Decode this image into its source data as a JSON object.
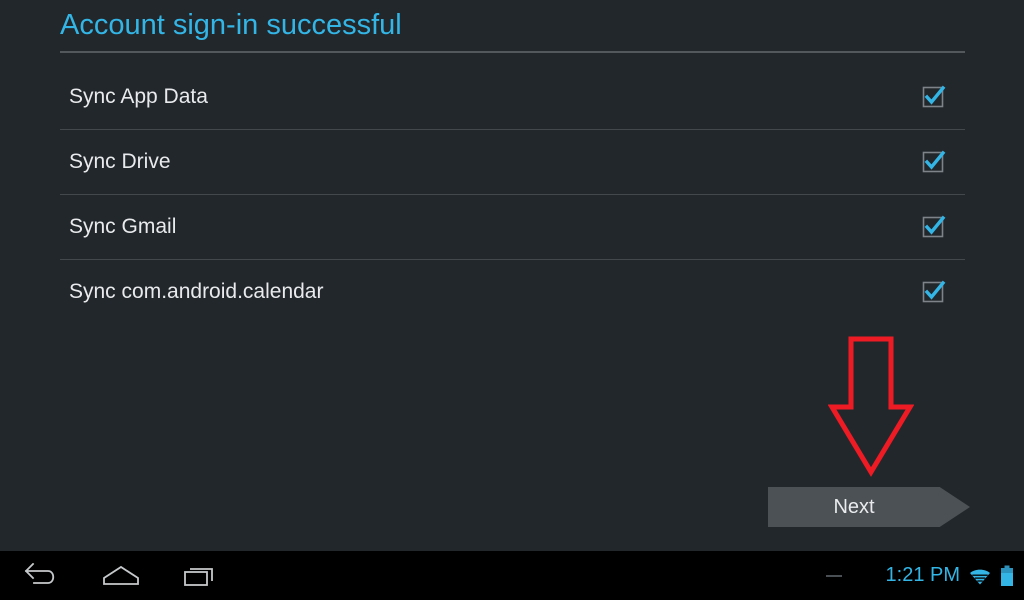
{
  "page": {
    "title": "Account sign-in successful",
    "background_color": "#22272c",
    "accent_color": "#33b5e5"
  },
  "sync_list": {
    "items": [
      {
        "label": "Sync App Data",
        "checked": true,
        "checkbox_icon": "checkbox-checked-icon"
      },
      {
        "label": "Sync Drive",
        "checked": true,
        "checkbox_icon": "checkbox-checked-icon"
      },
      {
        "label": "Sync Gmail",
        "checked": true,
        "checkbox_icon": "checkbox-checked-icon"
      },
      {
        "label": "Sync com.android.calendar",
        "checked": true,
        "checkbox_icon": "checkbox-checked-icon"
      }
    ]
  },
  "annotation": {
    "arrow_icon": "down-arrow-annotation-icon",
    "arrow_color": "#ee1b24"
  },
  "next_button": {
    "label": "Next",
    "fill_color": "#4c5155",
    "text_color": "#e9ebed"
  },
  "nav_bar": {
    "background_color": "#000000",
    "buttons": [
      {
        "name": "back-icon",
        "label": "Back"
      },
      {
        "name": "home-icon",
        "label": "Home"
      },
      {
        "name": "recents-icon",
        "label": "Recent apps"
      }
    ]
  },
  "status_bar": {
    "clock": "1:21 PM",
    "clock_color": "#33b5e5",
    "wifi_icon": "wifi-icon",
    "battery_icon": "battery-icon",
    "dash_icon": "notification-dash-icon"
  }
}
